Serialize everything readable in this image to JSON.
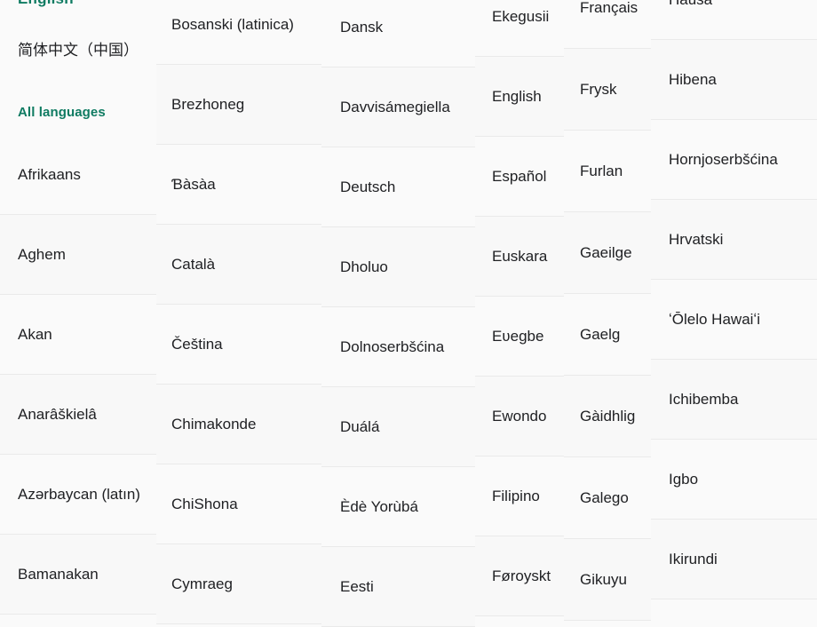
{
  "header": {
    "current_language_link": "English",
    "selected_locale": "简体中文（中国）",
    "all_languages_link": "All languages",
    "accent_color": "#0f7b62",
    "text_color": "#202124",
    "background_color": "#fafafa",
    "divider_color": "#eaeaea"
  },
  "columns": [
    {
      "name": "column-1",
      "items": [
        "Afrikaans",
        "Aghem",
        "Akan",
        "Anarâškielâ",
        "Azərbaycan (latın)",
        "Bamanakan"
      ]
    },
    {
      "name": "column-2",
      "items": [
        "Bosanski (latinica)",
        "Brezhoneg",
        "Ɓàsàa",
        "Català",
        "Čeština",
        "Chimakonde",
        "ChiShona",
        "Cymraeg"
      ]
    },
    {
      "name": "column-3",
      "items": [
        "Dansk",
        "Davvisámegiella",
        "Deutsch",
        "Dholuo",
        "Dolnoserbšćina",
        "Duálá",
        "Èdè Yorùbá",
        "Eesti"
      ]
    },
    {
      "name": "column-4",
      "items": [
        "Ekegusii",
        "English",
        "Español",
        "Euskara",
        "Eʋegbe",
        "Ewondo",
        "Filipino",
        "Føroyskt"
      ]
    },
    {
      "name": "column-5",
      "items": [
        "Français",
        "Frysk",
        "Furlan",
        "Gaeilge",
        "Gaelg",
        "Gàidhlig",
        "Galego",
        "Gikuyu"
      ]
    },
    {
      "name": "column-6",
      "items": [
        "Hausa",
        "Hibena",
        "Hornjoserbšćina",
        "Hrvatski",
        "ʻŌlelo Hawaiʻi",
        "Ichibemba",
        "Igbo",
        "Ikirundi"
      ]
    }
  ]
}
